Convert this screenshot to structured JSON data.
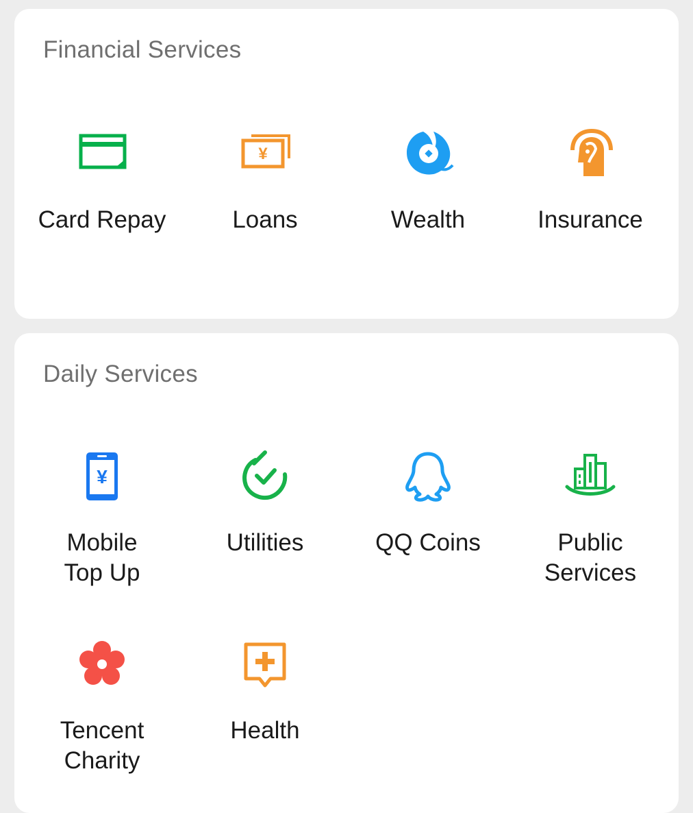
{
  "financial": {
    "title": "Financial Services",
    "items": [
      {
        "label": "Card Repay",
        "icon": "card-icon",
        "color": "#07b04b"
      },
      {
        "label": "Loans",
        "icon": "banknote-icon",
        "color": "#f3962e"
      },
      {
        "label": "Wealth",
        "icon": "wealth-coin-icon",
        "color": "#1e9ef2"
      },
      {
        "label": "Insurance",
        "icon": "shield-person-icon",
        "color": "#f3962e"
      }
    ]
  },
  "daily": {
    "title": "Daily Services",
    "items": [
      {
        "label": "Mobile\nTop Up",
        "icon": "phone-yuan-icon",
        "color": "#1a78f0"
      },
      {
        "label": "Utilities",
        "icon": "checkmark-circle-icon",
        "color": "#18b24a"
      },
      {
        "label": "QQ Coins",
        "icon": "penguin-icon",
        "color": "#1e9ef2"
      },
      {
        "label": "Public\nServices",
        "icon": "city-buildings-icon",
        "color": "#18b24a"
      },
      {
        "label": "Tencent\nCharity",
        "icon": "flower-icon",
        "color": "#f45147"
      },
      {
        "label": "Health",
        "icon": "medical-chat-icon",
        "color": "#f3962e"
      }
    ]
  }
}
